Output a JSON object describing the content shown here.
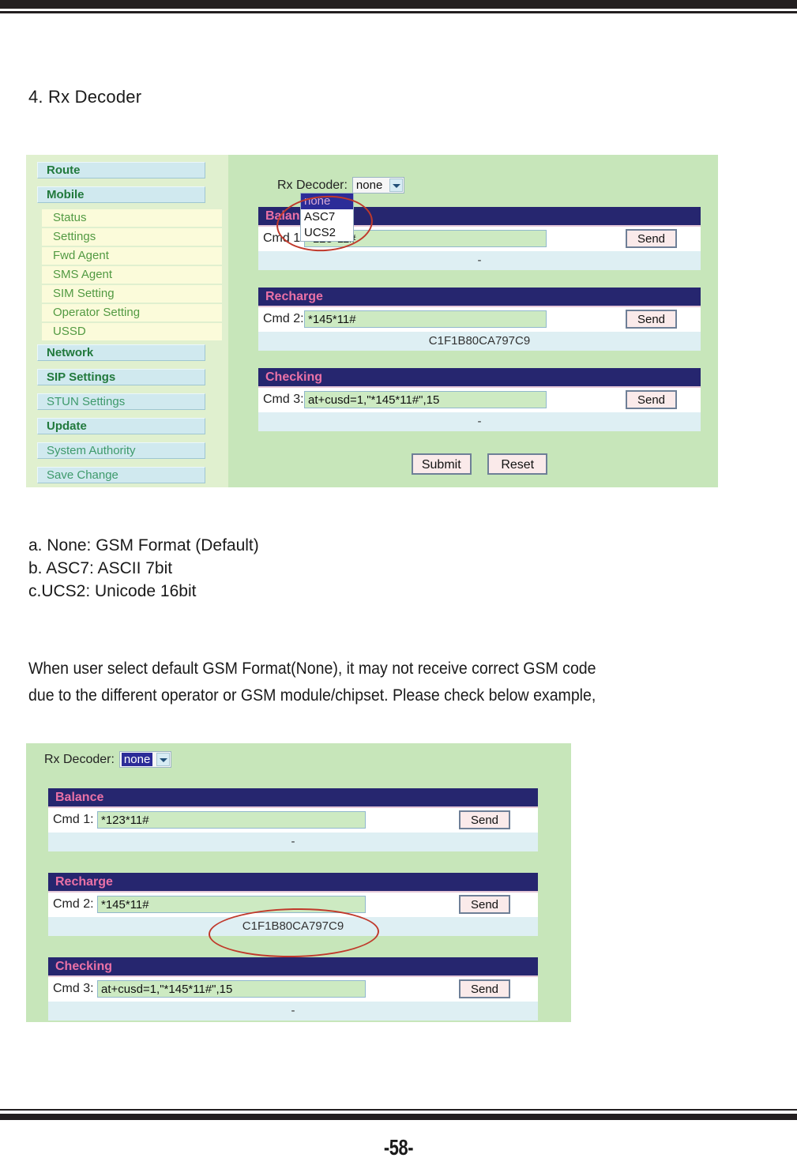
{
  "page": {
    "number": "-58-",
    "heading": "4. Rx Decoder",
    "definitions": [
      "a. None: GSM Format (Default)",
      "b. ASC7: ASCII 7bit",
      "c.UCS2: Unicode 16bit"
    ],
    "paragraph_lines": [
      "When user select default GSM Format(None), it may not receive correct GSM code",
      "due to the different operator or GSM module/chipset. Please check below example,"
    ]
  },
  "colors": {
    "panel_header_bg": "#262673",
    "panel_header_text": "#f06fa8",
    "screenshot_bg": "#c6e7b8",
    "sidebar_bg": "#dff0cd",
    "nav_main_bg": "#cfe9f0",
    "nav_sub_bg": "#fbfbd8",
    "annotation_red": "#c0392b",
    "input_bg": "#ccebc0",
    "result_bg": "#ddeff3"
  },
  "screenshot_1": {
    "sidebar": {
      "items": [
        {
          "label": "Route",
          "type": "main",
          "bold": true
        },
        {
          "label": "Mobile",
          "type": "main",
          "bold": true
        },
        {
          "label": "Status",
          "type": "sub"
        },
        {
          "label": "Settings",
          "type": "sub"
        },
        {
          "label": "Fwd Agent",
          "type": "sub"
        },
        {
          "label": "SMS Agent",
          "type": "sub"
        },
        {
          "label": "SIM Setting",
          "type": "sub"
        },
        {
          "label": "Operator Setting",
          "type": "sub"
        },
        {
          "label": "USSD",
          "type": "sub"
        },
        {
          "label": "Network",
          "type": "main",
          "bold": true
        },
        {
          "label": "SIP Settings",
          "type": "main",
          "bold": true
        },
        {
          "label": "STUN Settings",
          "type": "main",
          "bold": false
        },
        {
          "label": "Update",
          "type": "main",
          "bold": true
        },
        {
          "label": "System Authority",
          "type": "main",
          "bold": false
        },
        {
          "label": "Save Change",
          "type": "main",
          "bold": false
        }
      ]
    },
    "rx_decoder": {
      "label": "Rx Decoder:",
      "value": "none",
      "options": [
        "none",
        "ASC7",
        "UCS2"
      ],
      "selected_option": "none",
      "dropdown_open": true
    },
    "panels": [
      {
        "title": "Balance",
        "cmd_label": "Cmd 1:",
        "cmd_value": "*123*11#",
        "send_label": "Send",
        "result": "-"
      },
      {
        "title": "Recharge",
        "cmd_label": "Cmd 2:",
        "cmd_value": "*145*11#",
        "send_label": "Send",
        "result": "C1F1B80CA797C9"
      },
      {
        "title": "Checking",
        "cmd_label": "Cmd 3:",
        "cmd_value": "at+cusd=1,\"*145*11#\",15",
        "send_label": "Send",
        "result": "-"
      }
    ],
    "actions": {
      "submit_label": "Submit",
      "reset_label": "Reset"
    }
  },
  "screenshot_2": {
    "rx_decoder": {
      "label": "Rx Decoder:",
      "value": "none",
      "dropdown_open": false
    },
    "panels": [
      {
        "title": "Balance",
        "cmd_label": "Cmd 1:",
        "cmd_value": "*123*11#",
        "send_label": "Send",
        "result": "-"
      },
      {
        "title": "Recharge",
        "cmd_label": "Cmd 2:",
        "cmd_value": "*145*11#",
        "send_label": "Send",
        "result": "C1F1B80CA797C9"
      },
      {
        "title": "Checking",
        "cmd_label": "Cmd 3:",
        "cmd_value": "at+cusd=1,\"*145*11#\",15",
        "send_label": "Send",
        "result": "-"
      }
    ]
  }
}
